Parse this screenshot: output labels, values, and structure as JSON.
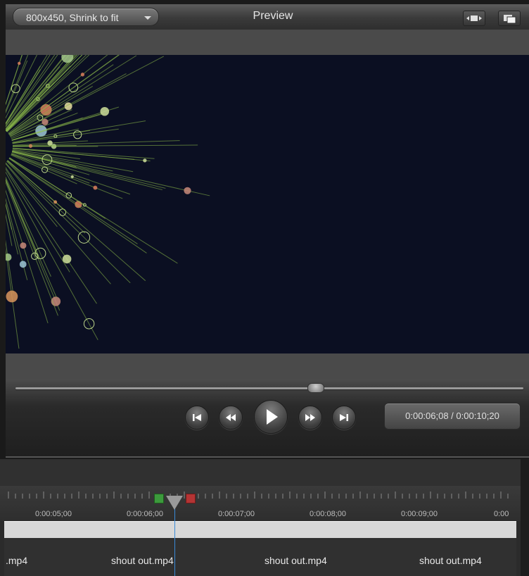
{
  "preview": {
    "title": "Preview",
    "size_dropdown": "800x450, Shrink to fit",
    "fit_button_icon": "fit-view-icon",
    "detach_button_icon": "detach-window-icon"
  },
  "playback": {
    "scrub_position": 0.59,
    "buttons": [
      "previous-clip-icon",
      "rewind-icon",
      "play-icon",
      "fast-forward-icon",
      "next-clip-icon"
    ],
    "timecode": "0:00:06;08 / 0:00:10;20"
  },
  "timeline": {
    "ruler_labels": [
      "0:00:05;00",
      "0:00:06;00",
      "0:00:07;00",
      "0:00:08;00",
      "0:00:09;00",
      "0:00"
    ],
    "clips": [
      ".mp4",
      "shout out.mp4",
      "shout out.mp4",
      "shout out.mp4"
    ],
    "playhead_color": "#3a8ad8",
    "in_marker_color": "#3c9a3c",
    "out_marker_color": "#b43434"
  }
}
